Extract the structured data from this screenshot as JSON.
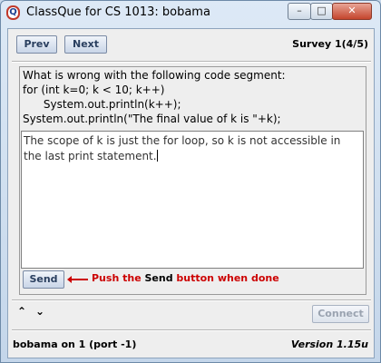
{
  "window": {
    "title": "ClassQue for CS 1013: bobama",
    "icon_letter": "Q",
    "minimize_glyph": "–",
    "maximize_glyph": "□",
    "close_glyph": "✕"
  },
  "toolbar": {
    "prev_label": "Prev",
    "next_label": "Next",
    "survey_label": "Survey 1(4/5)"
  },
  "question": {
    "lines": [
      "What is wrong with the following code segment:",
      "for (int k=0; k < 10; k++)",
      "      System.out.println(k++);",
      "System.out.println(\"The final value of k is \"+k);"
    ]
  },
  "answer": {
    "text": "The scope of k is just the for loop, so k is not accessible in the last print statement."
  },
  "send": {
    "label": "Send",
    "hint_prefix": "Push the ",
    "hint_emphasis": "Send",
    "hint_suffix": " button when done"
  },
  "navigation": {
    "up_glyph": "⌃",
    "down_glyph": "⌄"
  },
  "connect": {
    "label": "Connect"
  },
  "status": {
    "left": "bobama on 1 (port -1)",
    "right": "Version 1.15u"
  },
  "colors": {
    "hint_red": "#cc0000",
    "close_button": "#c4452d"
  }
}
